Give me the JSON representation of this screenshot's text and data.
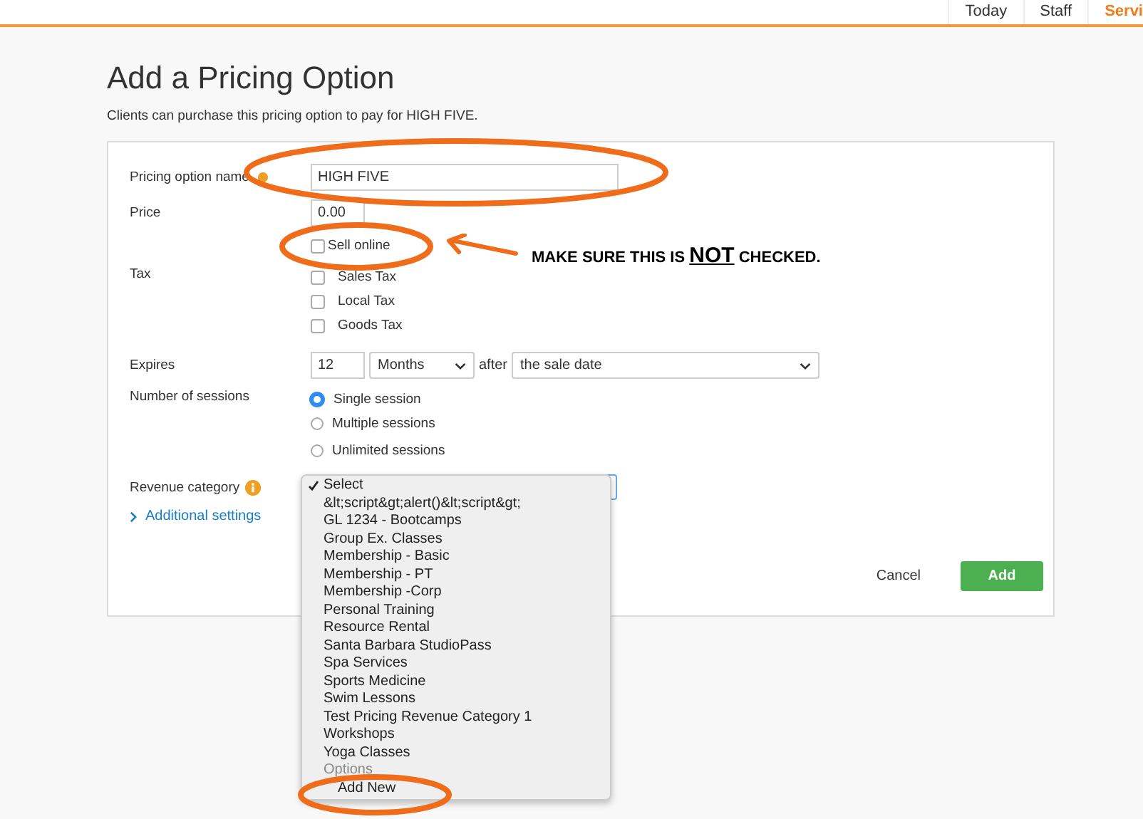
{
  "nav": {
    "tabs": [
      {
        "label": "Today",
        "selected": false
      },
      {
        "label": "Staff",
        "selected": false
      },
      {
        "label": "Servi",
        "selected": true
      }
    ]
  },
  "page": {
    "title": "Add a Pricing Option",
    "subtitle": "Clients can purchase this pricing option to pay for HIGH FIVE."
  },
  "form": {
    "name": {
      "label": "Pricing option name",
      "value": "HIGH FIVE"
    },
    "price": {
      "label": "Price",
      "value": "0.00"
    },
    "sell_online": {
      "label": "Sell online",
      "checked": false
    },
    "tax": {
      "label": "Tax",
      "options": [
        {
          "label": "Sales Tax",
          "checked": false
        },
        {
          "label": "Local Tax",
          "checked": false
        },
        {
          "label": "Goods Tax",
          "checked": false
        }
      ]
    },
    "expires": {
      "label": "Expires",
      "amount": "12",
      "unit": "Months",
      "connector": "after",
      "from": "the sale date"
    },
    "sessions": {
      "label": "Number of sessions",
      "options": [
        {
          "label": "Single session",
          "selected": true
        },
        {
          "label": "Multiple sessions",
          "selected": false
        },
        {
          "label": "Unlimited sessions",
          "selected": false
        }
      ]
    },
    "revenue": {
      "label": "Revenue category"
    },
    "additional": "Additional settings",
    "buttons": {
      "cancel": "Cancel",
      "add": "Add"
    }
  },
  "dropdown": {
    "items": [
      {
        "label": "Select",
        "selected": true,
        "kind": "option"
      },
      {
        "label": "&lt;script&gt;alert()&lt;script&gt;",
        "selected": false,
        "kind": "option"
      },
      {
        "label": "GL 1234 - Bootcamps",
        "selected": false,
        "kind": "option"
      },
      {
        "label": "Group Ex. Classes",
        "selected": false,
        "kind": "option"
      },
      {
        "label": "Membership - Basic",
        "selected": false,
        "kind": "option"
      },
      {
        "label": "Membership - PT",
        "selected": false,
        "kind": "option"
      },
      {
        "label": "Membership -Corp",
        "selected": false,
        "kind": "option"
      },
      {
        "label": "Personal Training",
        "selected": false,
        "kind": "option"
      },
      {
        "label": "Resource Rental",
        "selected": false,
        "kind": "option"
      },
      {
        "label": "Santa Barbara StudioPass",
        "selected": false,
        "kind": "option"
      },
      {
        "label": "Spa Services",
        "selected": false,
        "kind": "option"
      },
      {
        "label": "Sports Medicine",
        "selected": false,
        "kind": "option"
      },
      {
        "label": "Swim Lessons",
        "selected": false,
        "kind": "option"
      },
      {
        "label": "Test Pricing Revenue Category 1",
        "selected": false,
        "kind": "option"
      },
      {
        "label": "Workshops",
        "selected": false,
        "kind": "option"
      },
      {
        "label": "Yoga Classes",
        "selected": false,
        "kind": "option"
      },
      {
        "label": "Options",
        "selected": false,
        "kind": "group"
      },
      {
        "label": "Add New",
        "selected": false,
        "kind": "indented"
      }
    ]
  },
  "annotation": {
    "before": "MAKE SURE THIS IS",
    "emphasis": "NOT",
    "after": "CHECKED."
  }
}
